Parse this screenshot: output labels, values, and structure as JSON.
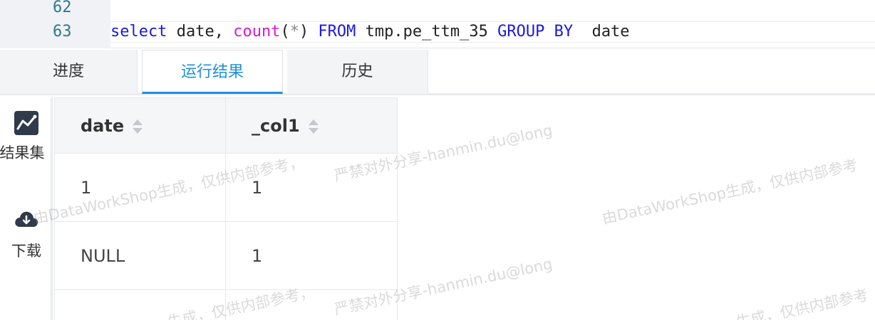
{
  "editor": {
    "lines": [
      {
        "number": "62",
        "code": ""
      },
      {
        "number": "63",
        "code_parts": [
          "select",
          " date, ",
          "count",
          "(",
          "*",
          ")",
          " FROM",
          " tmp.pe_ttm_35 ",
          "GROUP BY",
          "  date"
        ]
      }
    ]
  },
  "tabs": [
    {
      "label": "进度"
    },
    {
      "label": "运行结果",
      "active": true
    },
    {
      "label": "历史"
    }
  ],
  "side": {
    "result_set_label": "结果集",
    "download_label": "下载"
  },
  "table": {
    "columns": [
      "date",
      "_col1"
    ],
    "rows": [
      [
        "1",
        "1"
      ],
      [
        "NULL",
        "1"
      ]
    ]
  },
  "watermark": {
    "text_a": "严禁对外分享-hanmin.du@long",
    "text_b": "由DataWorkShop生成，仅供内部参考，",
    "text_c": "由DataWorkShop生成，仅供内部参考",
    "text_d": "生成，仅供内部参考，",
    "text_e": "生成，仅供内部参考"
  },
  "colors": {
    "keyword": "#1a1adb",
    "function": "#d61ad6",
    "active_tab": "#1f8fe0",
    "line_number": "#2b7a8c"
  }
}
